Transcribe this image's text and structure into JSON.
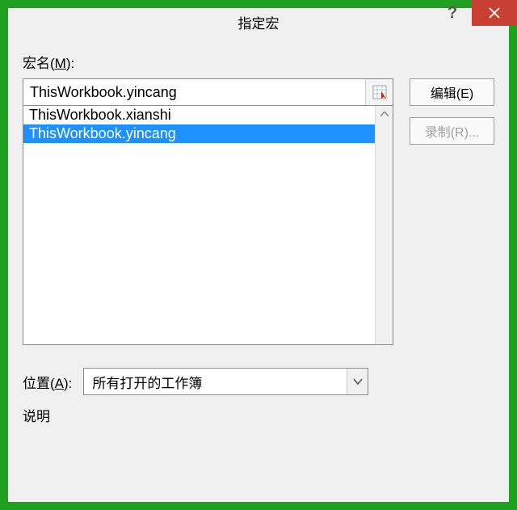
{
  "window": {
    "title": "指定宏"
  },
  "labels": {
    "macro_name": "宏名(",
    "macro_name_key": "M",
    "macro_name_end": "):",
    "location": "位置(",
    "location_key": "A",
    "location_end": "):",
    "description": "说明"
  },
  "macro_name_field": {
    "value": "ThisWorkbook.yincang"
  },
  "macro_list": [
    {
      "label": "ThisWorkbook.xianshi",
      "selected": false
    },
    {
      "label": "ThisWorkbook.yincang",
      "selected": true
    }
  ],
  "buttons": {
    "edit": "编辑(E)",
    "record": "录制(R)..."
  },
  "location_select": {
    "value": "所有打开的工作簿"
  }
}
